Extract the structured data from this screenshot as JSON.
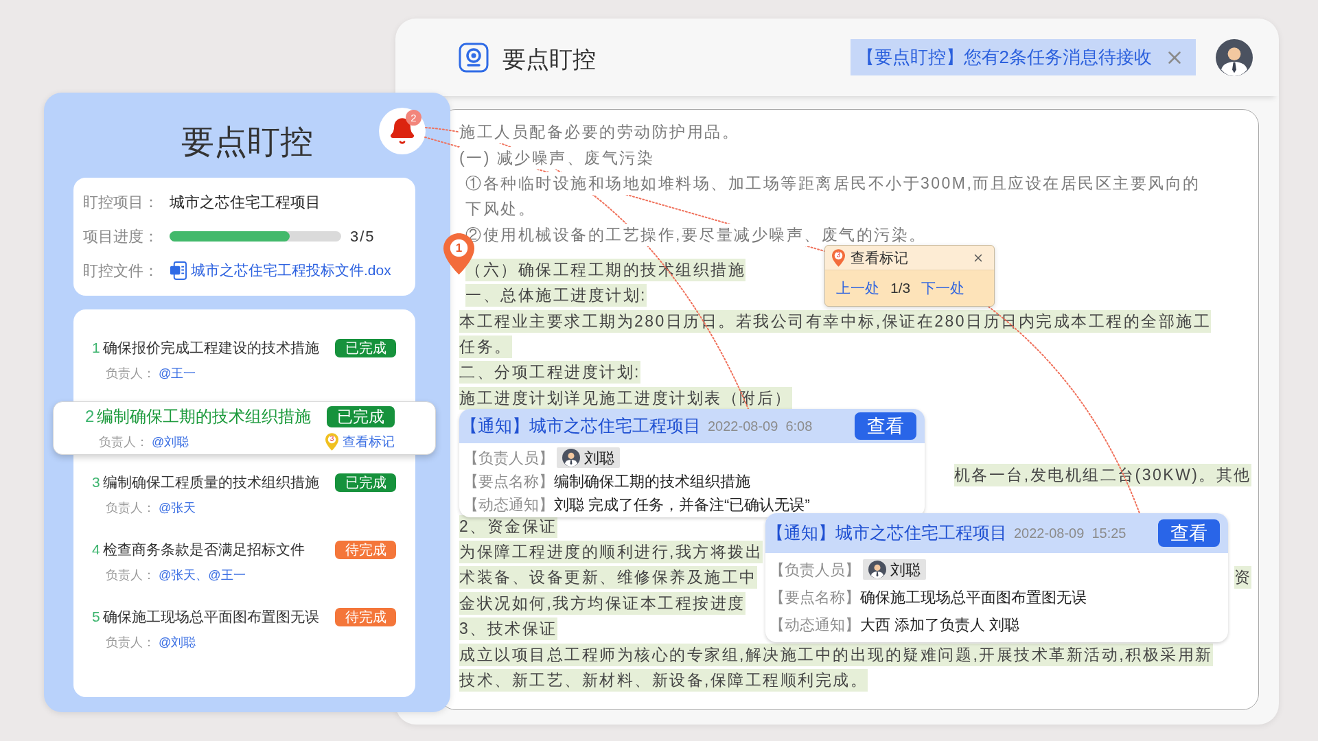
{
  "window": {
    "title": "要点盯控",
    "banner": "【要点盯控】您有2条任务消息待接收"
  },
  "left_panel": {
    "title": "要点盯控",
    "bell": {
      "count": "2"
    },
    "info": {
      "project": {
        "label": "盯控项目：",
        "value": "城市之芯住宅工程项目"
      },
      "progress": {
        "label": "项目进度：",
        "level": 0.7,
        "reading": "3/5"
      },
      "file": {
        "label": "盯控文件：",
        "name": "城市之芯住宅工程投标文件.dox"
      }
    },
    "tasks": [
      {
        "number": "1",
        "title": "确保报价完成工程建设的技术措施",
        "status": {
          "label": "已完成",
          "kind": "done"
        },
        "assignee_label": "负责人：",
        "assignees": "@王一",
        "selected": false
      },
      {
        "number": "2",
        "title": "编制确保工期的技术组织措施",
        "status": {
          "label": "已完成",
          "kind": "done"
        },
        "assignee_label": "负责人：",
        "assignees": "@刘聪",
        "selected": true,
        "marks": {
          "label": "查看标记",
          "count": "3"
        }
      },
      {
        "number": "3",
        "title": "编制确保工程质量的技术组织措施",
        "status": {
          "label": "已完成",
          "kind": "done"
        },
        "assignee_label": "负责人：",
        "assignees": "@张天",
        "selected": false
      },
      {
        "number": "4",
        "title": "检查商务条款是否满足招标文件",
        "status": {
          "label": "待完成",
          "kind": "pending"
        },
        "assignee_label": "负责人：",
        "assignees": "@张天、@王一",
        "selected": false
      },
      {
        "number": "5",
        "title": "确保施工现场总平面图布置图无误",
        "status": {
          "label": "待完成",
          "kind": "pending"
        },
        "assignee_label": "负责人：",
        "assignees": "@刘聪",
        "selected": false
      }
    ]
  },
  "document": {
    "marker": "1",
    "lines": [
      {
        "text": "施工人员配备必要的劳动防护用品。",
        "highlighted": false
      },
      {
        "text": "(一) 减少噪声、废气污染",
        "highlighted": false
      },
      {
        "text": "①各种临时设施和场地如堆料场、加工场等距离居民不小于300M,而且应设在居民区主要风向的",
        "highlighted": false
      },
      {
        "text": "下风处。",
        "highlighted": false
      },
      {
        "text": "②使用机械设备的工艺操作,要尽量减少噪声、废气的污染。",
        "highlighted": false
      },
      {
        "text": "（六）确保工程工期的技术组织措施",
        "highlighted": true
      },
      {
        "text": "一、总体施工进度计划:",
        "highlighted": true
      },
      {
        "text": "本工程业主要求工期为280日历日。若我公司有幸中标,保证在280日历日内完成本工程的全部施工",
        "highlighted": true
      },
      {
        "text": "任务。",
        "highlighted": true
      },
      {
        "text": "二、分项工程进度计划:",
        "highlighted": true
      },
      {
        "text": "施工进度计划详见施工进度计划表（附后）",
        "highlighted": true
      },
      {
        "text_end": "机各一台,发电机组二台(30KW)。其他",
        "highlighted": true
      },
      {
        "text": "2、资金保证",
        "highlighted": true
      },
      {
        "text": "为保障工程进度的顺利进行,我方将拨出",
        "highlighted": true
      },
      {
        "text": "术装备、设备更新、维修保养及施工中",
        "text_end": "资",
        "highlighted": true
      },
      {
        "text": "金状况如何,我方均保证本工程按进度",
        "highlighted": true
      },
      {
        "text": "3、技术保证",
        "highlighted": true
      },
      {
        "text": "成立以项目总工程师为核心的专家组,解决施工中的出现的疑难问题,开展技术革新活动,积极采用新",
        "highlighted": true
      },
      {
        "text": "技术、新工艺、新材料、新设备,保障工程顺利完成。",
        "highlighted": true
      }
    ]
  },
  "marker_popup": {
    "badge": "3",
    "title": "查看标记",
    "prev": "上一处",
    "position": "1/3",
    "next": "下一处"
  },
  "notifications": [
    {
      "title": "【通知】城市之芯住宅工程项目",
      "time": "2022-08-09  6:08",
      "button": "查看",
      "fields": [
        {
          "label": "【负责人员】",
          "kind": "person",
          "value": "刘聪"
        },
        {
          "label": "【要点名称】",
          "kind": "text",
          "value": "编制确保工期的技术组织措施"
        },
        {
          "label": "【动态通知】",
          "kind": "text",
          "value": "刘聪 完成了任务，并备注“已确认无误”"
        }
      ]
    },
    {
      "title": "【通知】城市之芯住宅工程项目",
      "time": "2022-08-09  15:25",
      "button": "查看",
      "fields": [
        {
          "label": "【负责人员】",
          "kind": "person",
          "value": "刘聪"
        },
        {
          "label": "【要点名称】",
          "kind": "text",
          "value": "确保施工现场总平面图布置图无误"
        },
        {
          "label": "【动态通知】",
          "kind": "text",
          "value": "大西 添加了负责人 刘聪"
        }
      ]
    }
  ]
}
